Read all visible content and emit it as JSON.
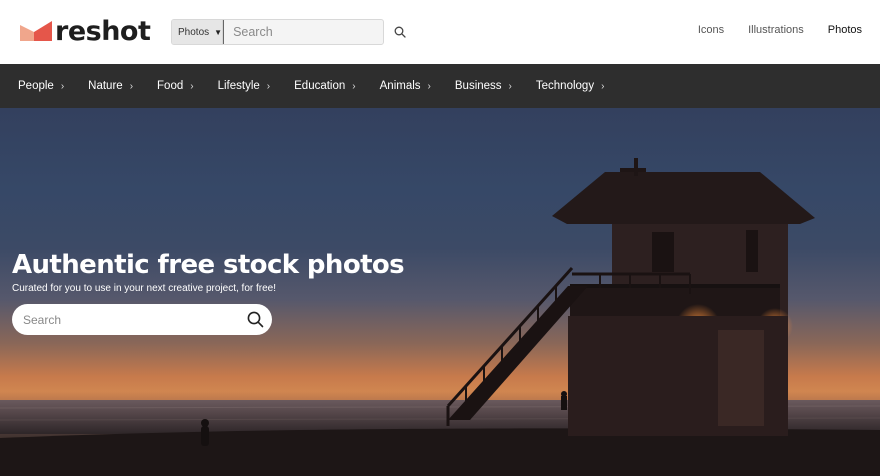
{
  "brand": {
    "name": "reshot"
  },
  "top_search": {
    "scope_label": "Photos",
    "placeholder": "Search"
  },
  "main_nav": {
    "icons": "Icons",
    "illustrations": "Illustrations",
    "photos": "Photos"
  },
  "categories": [
    "People",
    "Nature",
    "Food",
    "Lifestyle",
    "Education",
    "Animals",
    "Business",
    "Technology"
  ],
  "hero": {
    "title": "Authentic free stock photos",
    "subtitle": "Curated for you to use in your next creative project, for free!",
    "search_placeholder": "Search"
  },
  "icons": {
    "logo": "reshot-logo-icon",
    "scope_caret": "caret-down-icon",
    "search": "search-icon",
    "category_chevron": "chevron-right-icon"
  },
  "colors": {
    "category_bar": "#2e2e2e",
    "logo_red": "#e5564a",
    "logo_peach": "#f0a68c"
  }
}
